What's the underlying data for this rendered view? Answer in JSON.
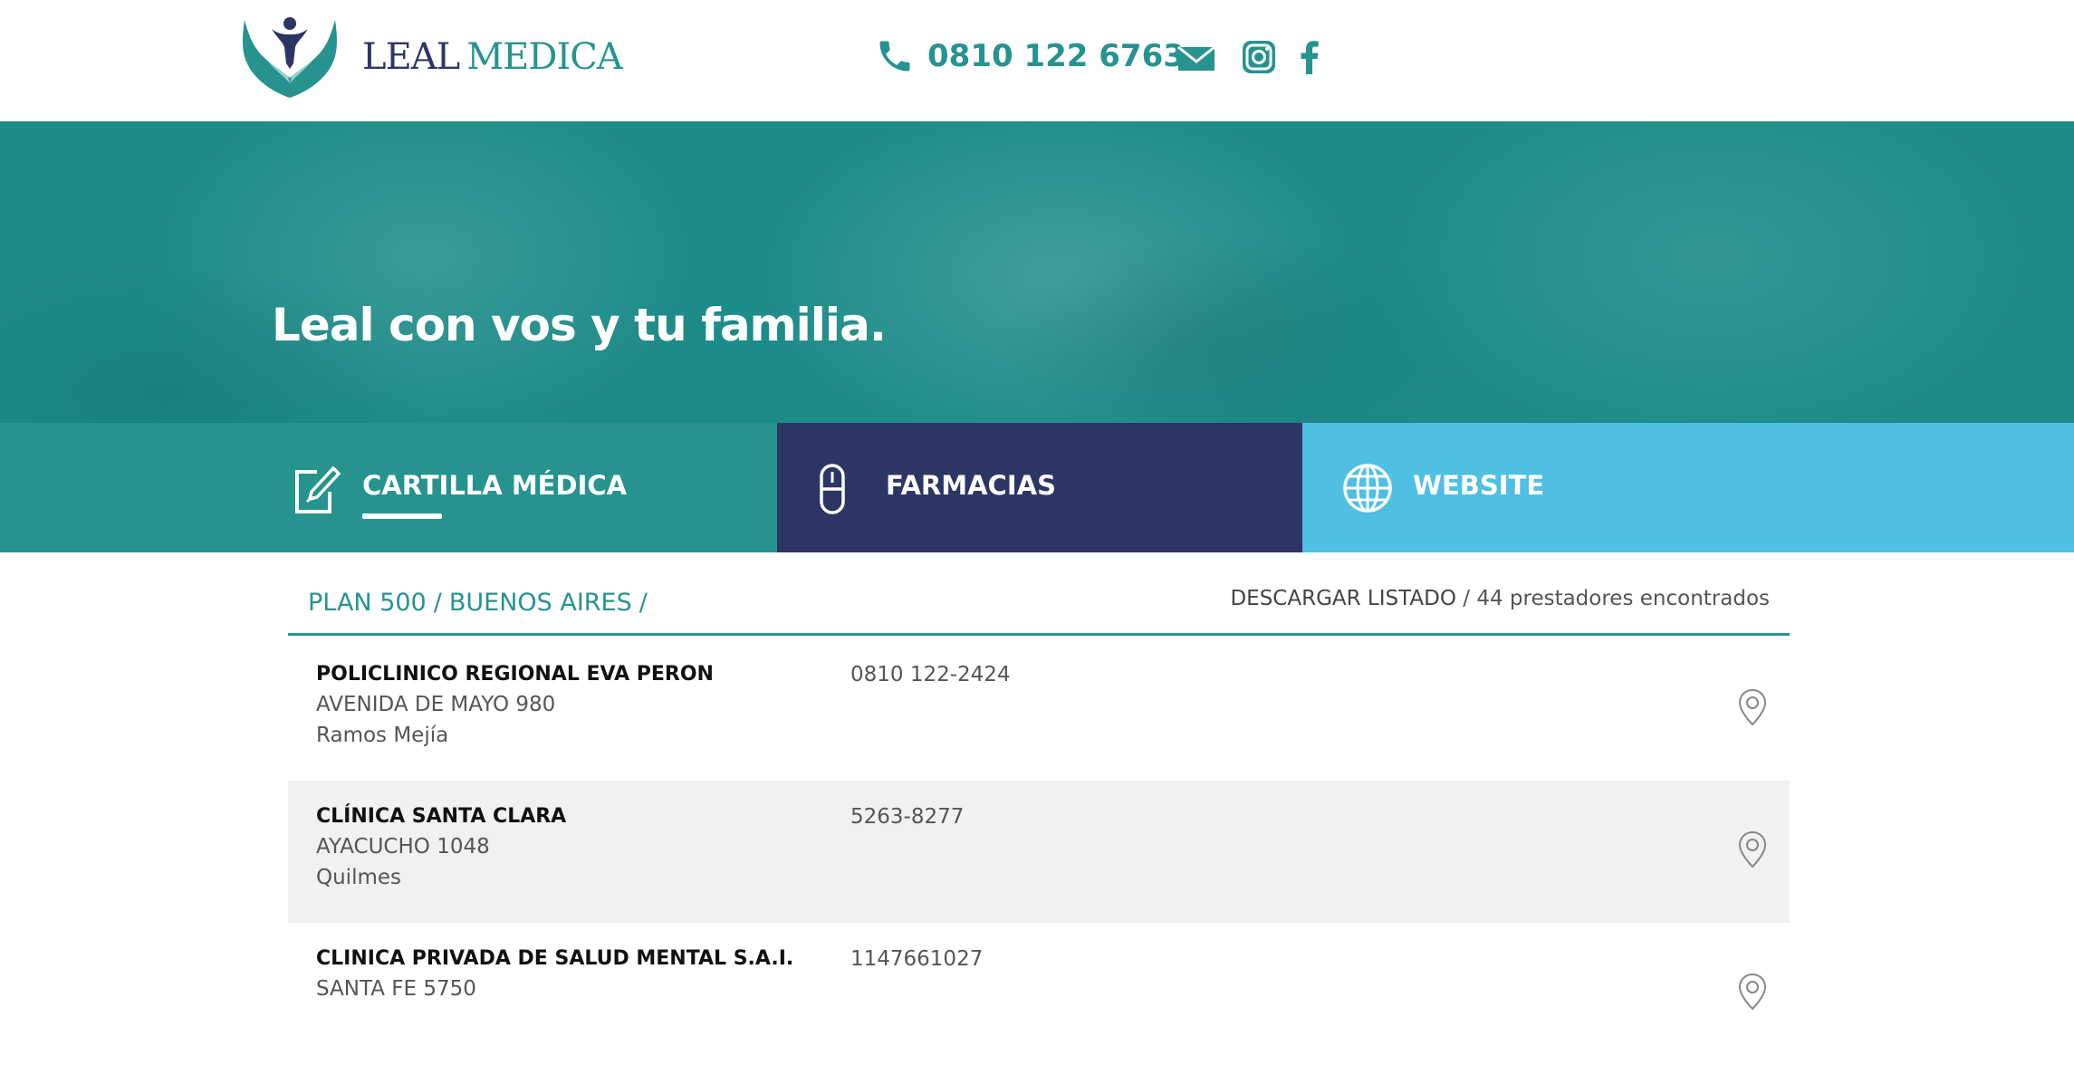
{
  "header": {
    "logo_word1": "LEAL",
    "logo_word2": "MEDICA",
    "phone_icon": "phone-icon",
    "phone": "0810 122 6763",
    "social": [
      {
        "icon": "mail-icon"
      },
      {
        "icon": "instagram-icon"
      },
      {
        "icon": "facebook-icon"
      }
    ]
  },
  "hero": {
    "title": "Leal con vos y tu familia."
  },
  "tabs": [
    {
      "label": "CARTILLA MÉDICA",
      "icon": "edit-document-icon",
      "color": "#26938f",
      "active": true
    },
    {
      "label": "FARMACIAS",
      "icon": "pill-icon",
      "color": "#2d3564",
      "active": false
    },
    {
      "label": "WEBSITE",
      "icon": "globe-icon",
      "color": "#4fbfe3",
      "active": false
    }
  ],
  "listing": {
    "breadcrumb": [
      "PLAN 500",
      "BUENOS AIRES"
    ],
    "download_label": "DESCARGAR LISTADO",
    "count_text": "44 prestadores encontrados",
    "rows": [
      {
        "name": "POLICLINICO REGIONAL EVA PERON",
        "address": "AVENIDA DE MAYO 980",
        "city": "Ramos Mejía",
        "phone": "0810 122-2424"
      },
      {
        "name": "CLÍNICA SANTA CLARA",
        "address": "AYACUCHO 1048",
        "city": "Quilmes",
        "phone": "5263-8277"
      },
      {
        "name": "CLINICA PRIVADA DE SALUD MENTAL S.A.I.",
        "address": "SANTA FE 5750",
        "city": "",
        "phone": "1147661027"
      }
    ]
  },
  "colors": {
    "teal": "#26938f",
    "navy": "#2d3564",
    "sky": "#4fbfe3"
  }
}
